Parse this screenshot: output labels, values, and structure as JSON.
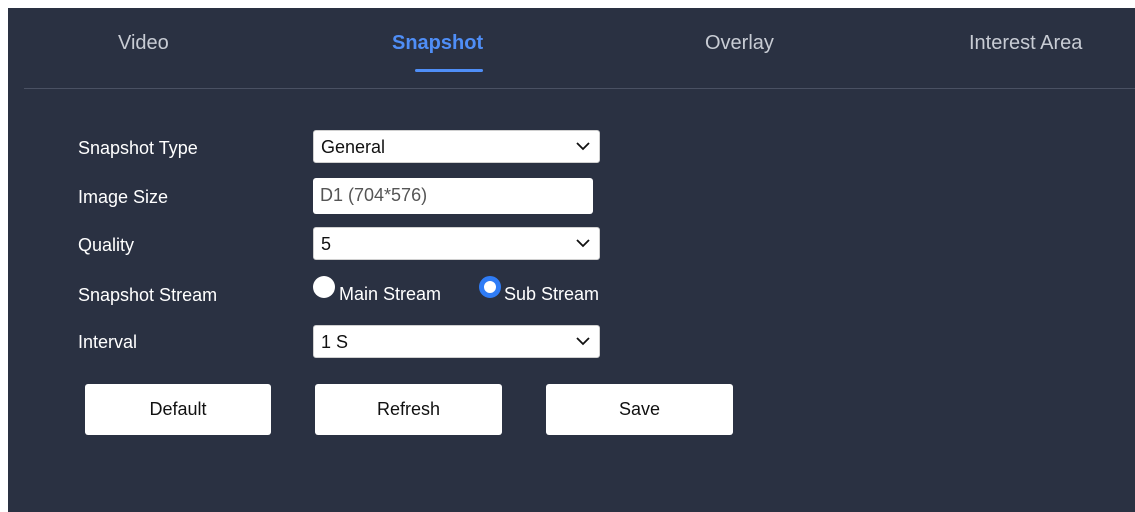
{
  "tabs": {
    "video": "Video",
    "snapshot": "Snapshot",
    "overlay": "Overlay",
    "interest_area": "Interest Area",
    "active": "Snapshot"
  },
  "form": {
    "snapshot_type": {
      "label": "Snapshot Type",
      "value": "General"
    },
    "image_size": {
      "label": "Image Size",
      "value": "D1 (704*576)"
    },
    "quality": {
      "label": "Quality",
      "value": "5"
    },
    "snapshot_stream": {
      "label": "Snapshot Stream",
      "options": [
        "Main Stream",
        "Sub Stream"
      ],
      "selected": "Sub Stream"
    },
    "interval": {
      "label": "Interval",
      "value": "1 S"
    }
  },
  "buttons": {
    "default": "Default",
    "refresh": "Refresh",
    "save": "Save"
  },
  "colors": {
    "background": "#2a3142",
    "accent": "#4f8ef7",
    "radio_selected": "#2f7cf6"
  },
  "icons": {
    "dropdown": "chevron-down-icon"
  }
}
